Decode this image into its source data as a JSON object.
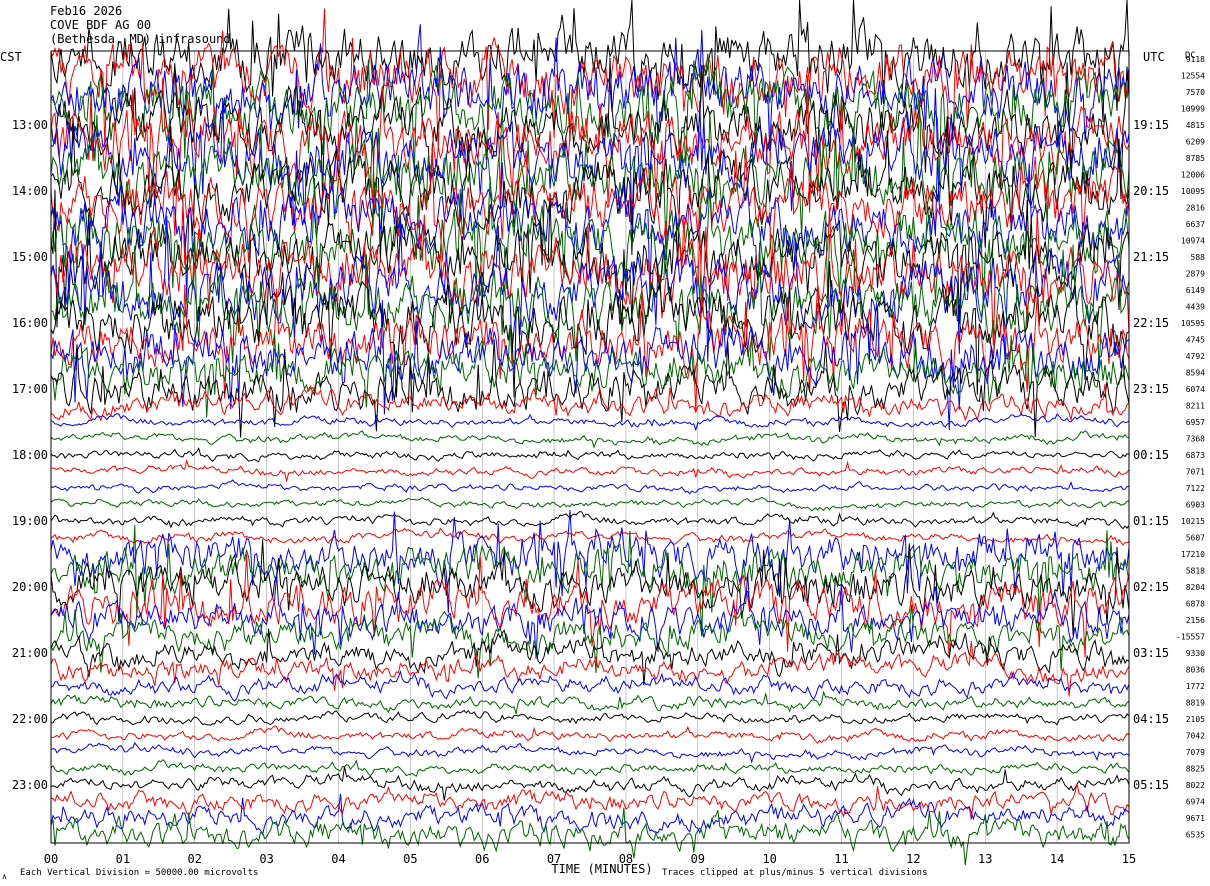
{
  "header": {
    "date": "Feb16 2026",
    "station": "COVE BDF AG 00",
    "location": "(Bethesda, MD) infrasound"
  },
  "labels": {
    "left_zone": "CST",
    "right_zone": "UTC",
    "dc": "DC",
    "xaxis_title": "TIME (MINUTES)",
    "scale_note": "Each Vertical Division = 50000.00 microvolts",
    "clip_note": "Traces clipped at plus/minus 5 vertical divisions",
    "corner_mark": "∧"
  },
  "colors": {
    "trace_cycle": [
      "#000000",
      "#ff0000",
      "#0000ff",
      "#006400"
    ],
    "grid": "#a0a0a0",
    "frame": "#000000"
  },
  "chart_data": {
    "type": "line",
    "chart_kind": "helicorder",
    "xlim": [
      0,
      15
    ],
    "x_ticks": [
      "00",
      "01",
      "02",
      "03",
      "04",
      "05",
      "06",
      "07",
      "08",
      "09",
      "10",
      "11",
      "12",
      "13",
      "14",
      "15"
    ],
    "left_hour_labels": [
      "13:00",
      "14:00",
      "15:00",
      "16:00",
      "17:00",
      "18:00",
      "19:00",
      "20:00",
      "21:00",
      "22:00",
      "23:00"
    ],
    "right_hour_labels": [
      "19:15",
      "20:15",
      "21:15",
      "22:15",
      "23:15",
      "00:15",
      "01:15",
      "02:15",
      "03:15",
      "04:15",
      "05:15"
    ],
    "dc_offsets": [
      "9118",
      "12554",
      "7570",
      "10999",
      "4815",
      "6209",
      "8785",
      "12006",
      "10095",
      "2816",
      "6637",
      "10974",
      "588",
      "2879",
      "6149",
      "4439",
      "10595",
      "4745",
      "4792",
      "8594",
      "6074",
      "8211",
      "6957",
      "7368",
      "6873",
      "7071",
      "7122",
      "6903",
      "10215",
      "5607",
      "17210",
      "5818",
      "8204",
      "6878",
      "2156",
      "-15557",
      "9330",
      "8036",
      "1772",
      "8819",
      "2105",
      "7042",
      "7079",
      "8825",
      "8022",
      "6974",
      "9671",
      "6535"
    ],
    "trace_activity": [
      6,
      6,
      6,
      6,
      6,
      6,
      6,
      6,
      6,
      6,
      6,
      6,
      6,
      6,
      6,
      6,
      6,
      5,
      5,
      4,
      4,
      2,
      0.7,
      0.7,
      0.7,
      0.7,
      0.6,
      0.6,
      0.8,
      0.8,
      4,
      4,
      4,
      4,
      3.5,
      3,
      2.5,
      2,
      1.5,
      1,
      0.8,
      0.8,
      0.8,
      0.8,
      1.2,
      1.6,
      2,
      2.5
    ]
  }
}
